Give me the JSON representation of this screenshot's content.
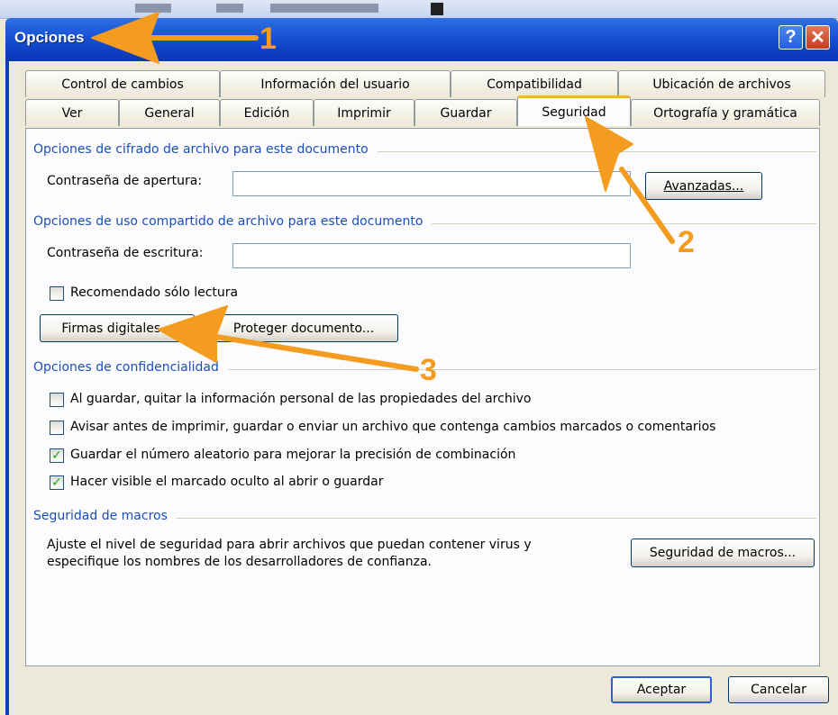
{
  "window": {
    "title": "Opciones",
    "help_glyph": "?",
    "close_glyph": "✕"
  },
  "tabs_row1": [
    "Control de cambios",
    "Información del usuario",
    "Compatibilidad",
    "Ubicación de archivos"
  ],
  "tabs_row2": [
    "Ver",
    "General",
    "Edición",
    "Imprimir",
    "Guardar",
    "Seguridad",
    "Ortografía y gramática"
  ],
  "active_tab": "Seguridad",
  "encryption": {
    "section": "Opciones de cifrado de archivo para este documento",
    "open_pwd_label": "Contraseña de apertura:",
    "open_pwd_value": "",
    "advanced_button": "Avanzadas..."
  },
  "sharing": {
    "section": "Opciones de uso compartido de archivo para este documento",
    "write_pwd_label": "Contraseña de escritura:",
    "write_pwd_value": "",
    "readonly_label": "Recomendado sólo lectura",
    "readonly_checked": false,
    "digital_signatures_button": "Firmas digitales...",
    "protect_document_button": "Proteger documento..."
  },
  "privacy": {
    "section": "Opciones de confidencialidad",
    "options": [
      {
        "label": "Al guardar, quitar la información personal de las propiedades del archivo",
        "checked": false
      },
      {
        "label": "Avisar antes de imprimir, guardar o enviar un archivo que contenga cambios marcados o comentarios",
        "checked": false
      },
      {
        "label": "Guardar el número aleatorio para mejorar la precisión de combinación",
        "checked": true
      },
      {
        "label": "Hacer visible el marcado oculto al abrir o guardar",
        "checked": true
      }
    ]
  },
  "macros": {
    "section": "Seguridad de macros",
    "description_line1": "Ajuste el nivel de seguridad para abrir archivos que puedan contener virus y",
    "description_line2": "especifique los nombres de los desarrolladores de confianza.",
    "button": "Seguridad de macros..."
  },
  "footer": {
    "ok": "Aceptar",
    "cancel": "Cancelar"
  },
  "annotations": {
    "step1": "1",
    "step2": "2",
    "step3": "3",
    "arrow_color": "#F39C1F"
  }
}
